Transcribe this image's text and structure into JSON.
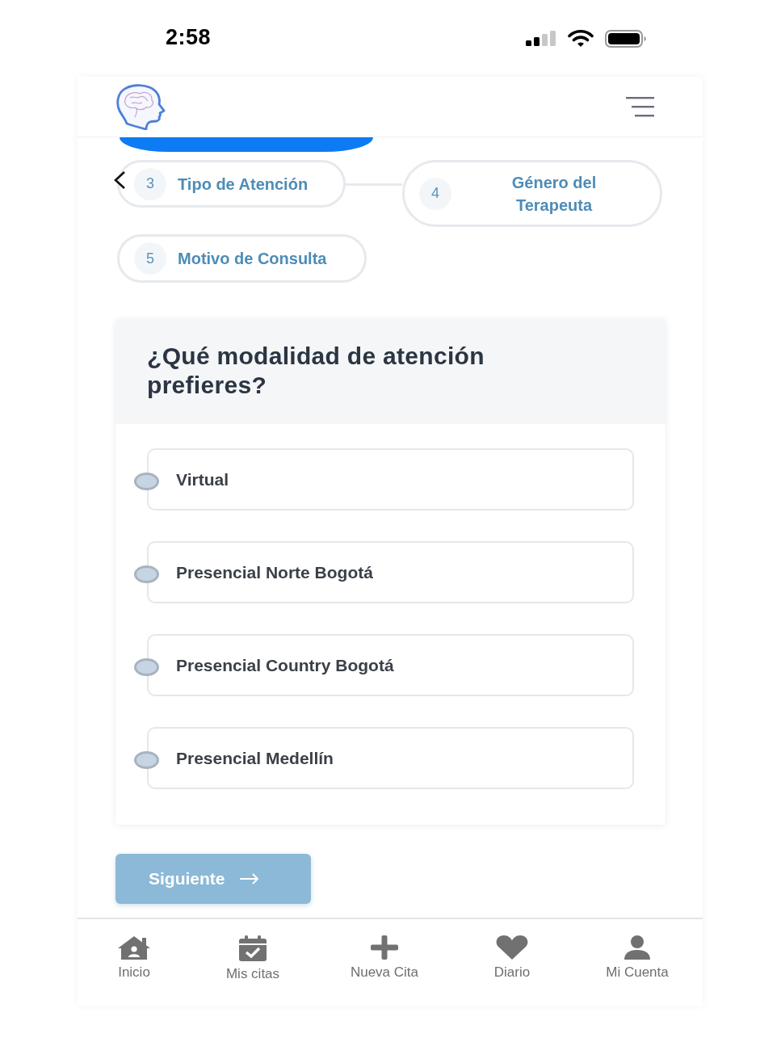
{
  "status_bar": {
    "time": "2:58"
  },
  "steps": [
    {
      "number": "3",
      "label": "Tipo de Atención"
    },
    {
      "number": "4",
      "label": "Género del Terapeuta"
    },
    {
      "number": "5",
      "label": "Motivo de Consulta"
    }
  ],
  "question": {
    "title": "¿Qué modalidad de atención prefieres?",
    "options": [
      {
        "label": "Virtual",
        "selected": false
      },
      {
        "label": "Presencial Norte Bogotá",
        "selected": false
      },
      {
        "label": "Presencial Country Bogotá",
        "selected": false
      },
      {
        "label": "Presencial Medellín",
        "selected": false
      }
    ]
  },
  "next_button": {
    "label": "Siguiente"
  },
  "bottom_nav": [
    {
      "kind": "home",
      "label": "Inicio"
    },
    {
      "kind": "calendar",
      "label": "Mis citas"
    },
    {
      "kind": "plus",
      "label": "Nueva Cita"
    },
    {
      "kind": "heart",
      "label": "Diario"
    },
    {
      "kind": "user",
      "label": "Mi Cuenta"
    }
  ]
}
